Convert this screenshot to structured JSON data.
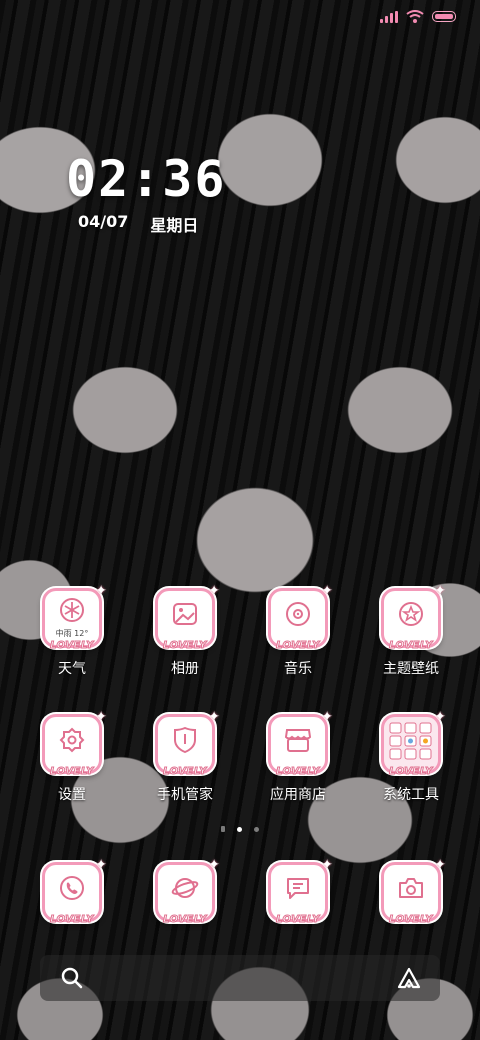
{
  "clock": {
    "time": "02:36",
    "date": "04/07",
    "weekday": "星期日"
  },
  "weather_widget": {
    "text": "中雨 12°"
  },
  "badge_text": "LOVELY",
  "apps_row1": [
    {
      "label": "天气",
      "icon": "weather-snow-icon"
    },
    {
      "label": "相册",
      "icon": "gallery-icon"
    },
    {
      "label": "音乐",
      "icon": "music-disc-icon"
    },
    {
      "label": "主题壁纸",
      "icon": "theme-star-icon"
    }
  ],
  "apps_row2": [
    {
      "label": "设置",
      "icon": "settings-gear-icon"
    },
    {
      "label": "手机管家",
      "icon": "shield-icon"
    },
    {
      "label": "应用商店",
      "icon": "store-icon"
    },
    {
      "label": "系统工具",
      "icon": "folder-icon"
    }
  ],
  "dock": [
    {
      "label": "Phone",
      "icon": "phone-icon"
    },
    {
      "label": "Browser",
      "icon": "planet-icon"
    },
    {
      "label": "Messages",
      "icon": "message-icon"
    },
    {
      "label": "Camera",
      "icon": "camera-icon"
    }
  ],
  "colors": {
    "accent": "#f39ab9",
    "accent_dark": "#e0708f",
    "text": "#ffffff"
  }
}
